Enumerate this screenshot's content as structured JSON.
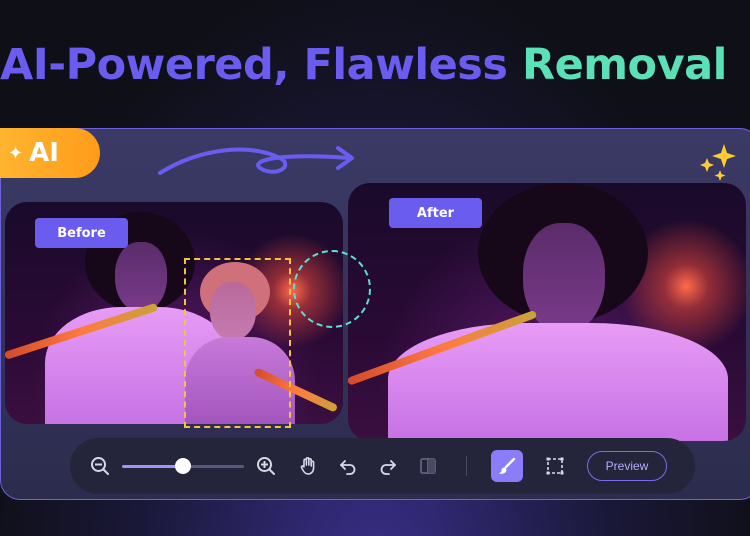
{
  "headline": {
    "part1": "AI-Powered, Flawless ",
    "part2": "Removal"
  },
  "badge": {
    "label": "AI"
  },
  "before_label": "Before",
  "after_label": "After",
  "toolbar": {
    "zoom_level": 0.5,
    "preview_label": "Preview"
  },
  "colors": {
    "accent": "#6b5cf0",
    "highlight": "#5ce0b8",
    "badge": "#ffa826"
  }
}
